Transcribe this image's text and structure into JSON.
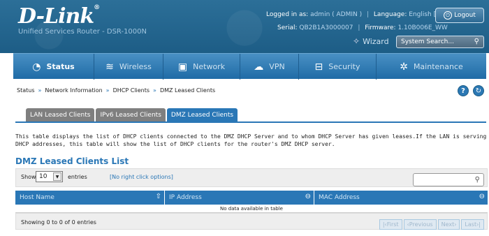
{
  "header": {
    "logo": "D-Link",
    "logo_reg": "®",
    "subtitle": "Unified Services Router - DSR-1000N",
    "logged_label": "Logged in as:",
    "logged_value": "admin ( ADMIN )",
    "language_label": "Language:",
    "language_value": "English [US]",
    "logout": "Logout",
    "serial_label": "Serial:",
    "serial_value": "QB2B1A3000007",
    "firmware_label": "Firmware:",
    "firmware_value": "1.10B006E_WW",
    "wizard": "Wizard",
    "search_placeholder": "System Search..."
  },
  "nav": [
    {
      "label": "Status",
      "icon": "gauge-icon",
      "glyph": "◔"
    },
    {
      "label": "Wireless",
      "icon": "wifi-icon",
      "glyph": "≋"
    },
    {
      "label": "Network",
      "icon": "monitor-icon",
      "glyph": "▣"
    },
    {
      "label": "VPN",
      "icon": "cloud-icon",
      "glyph": "☁"
    },
    {
      "label": "Security",
      "icon": "lock-icon",
      "glyph": "⊟"
    },
    {
      "label": "Maintenance",
      "icon": "gears-icon",
      "glyph": "✲"
    }
  ],
  "breadcrumb": [
    "Status",
    "Network Information",
    "DHCP Clients",
    "DMZ Leased Clients"
  ],
  "breadcrumb_sep": "»",
  "tabs": [
    "LAN Leased Clients",
    "IPv6 Leased Clients",
    "DMZ Leased Clients"
  ],
  "description": "This table displays the list of DHCP clients connected to the DMZ DHCP Server and to whom DHCP Server has given leases.If the LAN is serving DHCP addresses, this table will show the list of DHCP clients for the router's DMZ DHCP server.",
  "section_title": "DMZ Leased Clients List",
  "table": {
    "show_label": "Show",
    "entries_value": "10",
    "entries_label": "entries",
    "right_click": "[No right click options]",
    "columns": [
      "Host Name",
      "IP Address",
      "MAC Address"
    ],
    "empty": "No data available in table",
    "showing": "Showing 0 to 0 of 0 entries",
    "pager": [
      "First",
      "Previous",
      "Next",
      "Last"
    ]
  }
}
